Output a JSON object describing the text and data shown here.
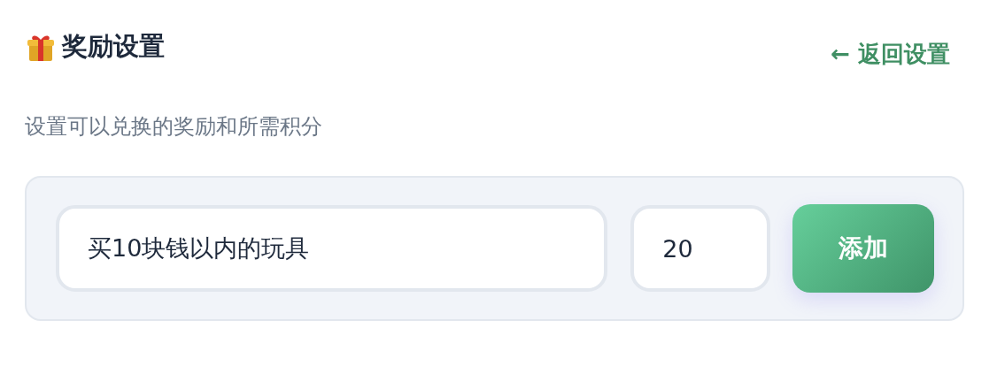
{
  "header": {
    "title": "奖励设置",
    "back_link": "← 返回设置"
  },
  "description": "设置可以兑换的奖励和所需积分",
  "form": {
    "reward_name": {
      "value": "买10块钱以内的玩具"
    },
    "points": {
      "value": "20"
    },
    "button": "添加"
  }
}
